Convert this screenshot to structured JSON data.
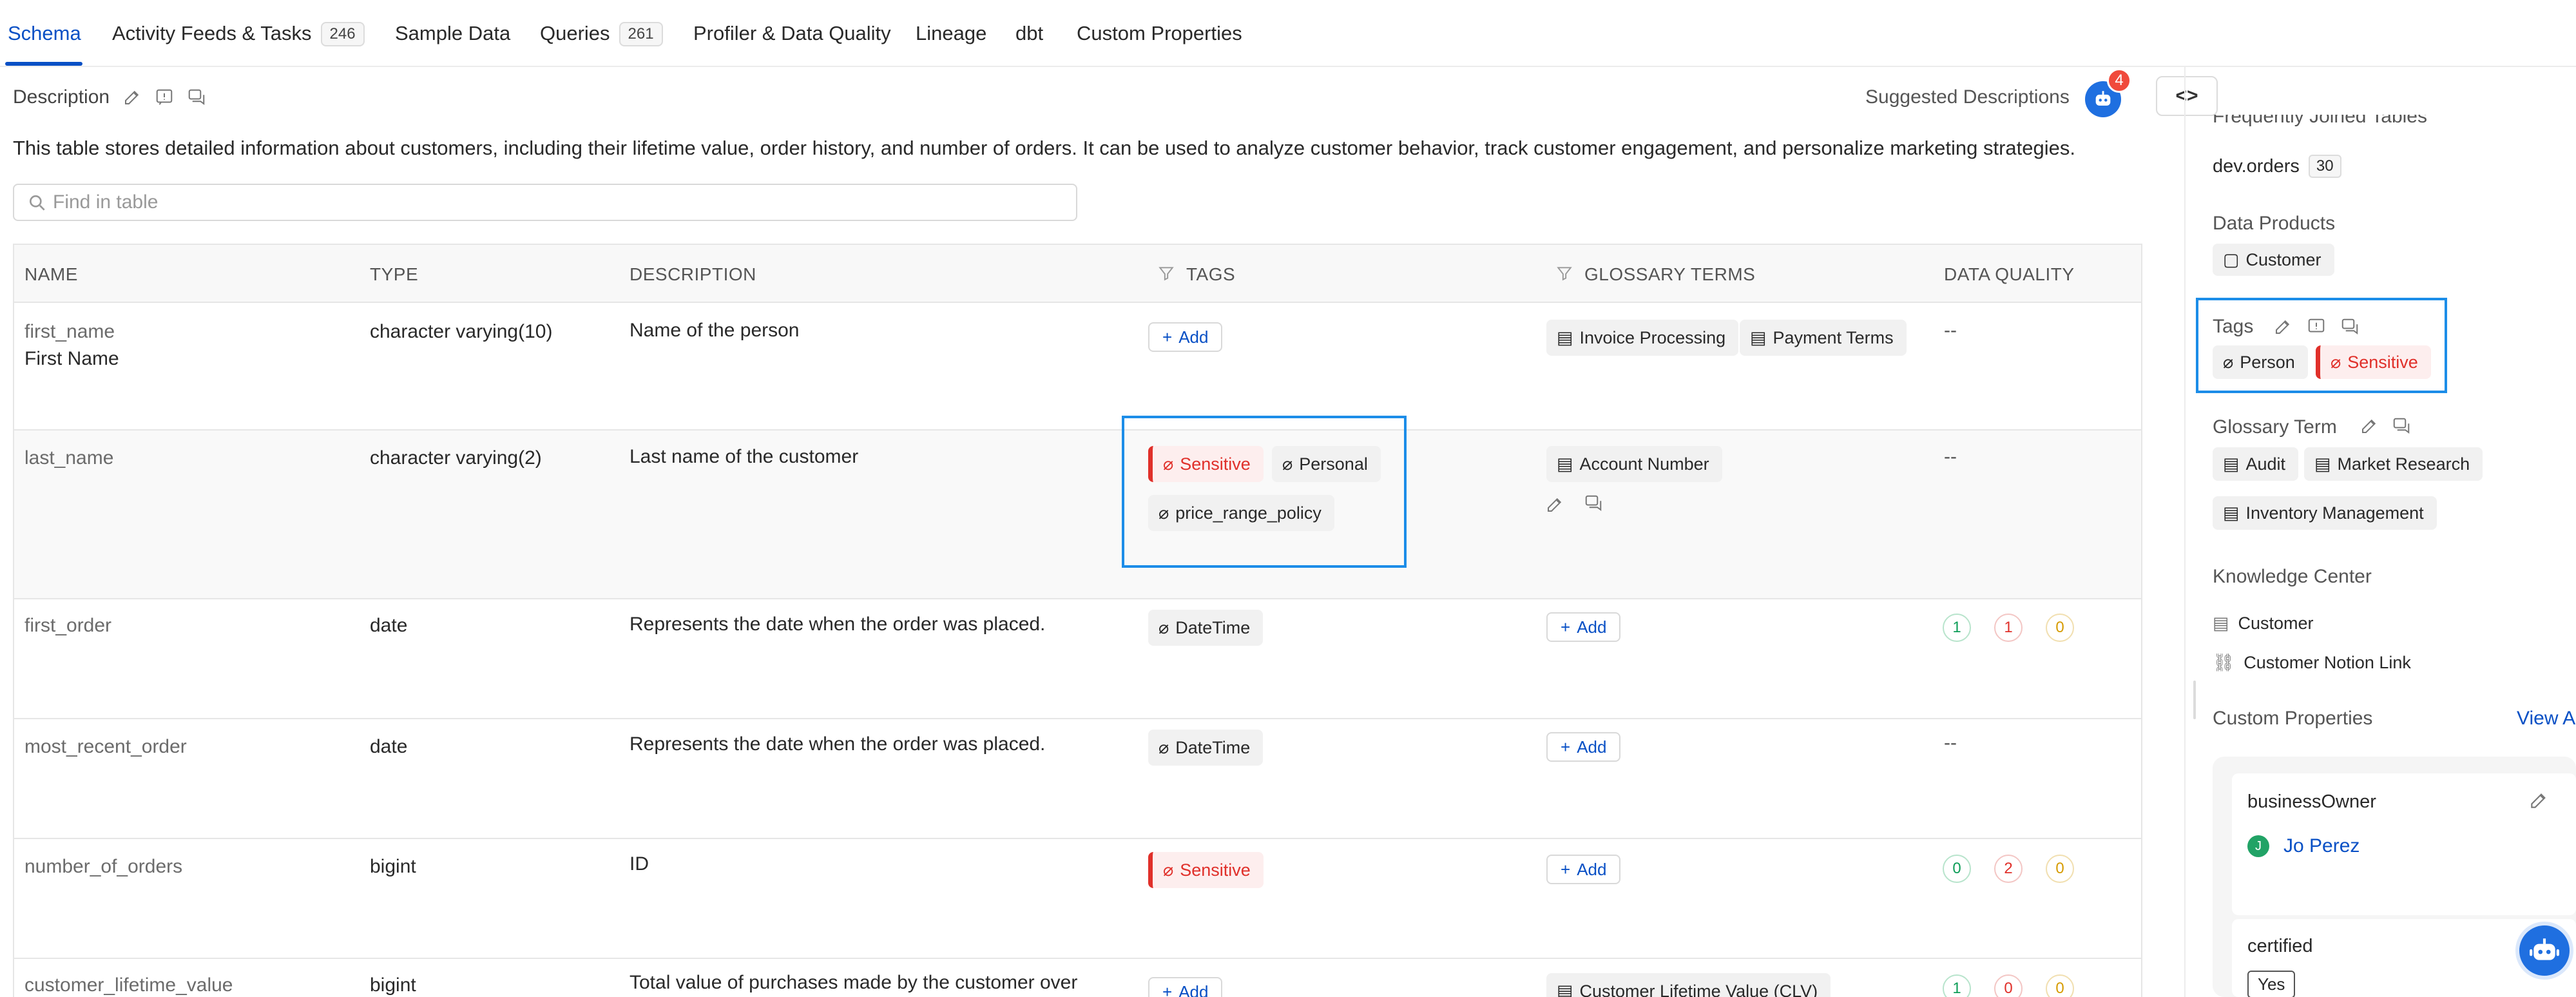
{
  "tabs": [
    {
      "label": "Schema",
      "count": null,
      "active": true
    },
    {
      "label": "Activity Feeds & Tasks",
      "count": "246"
    },
    {
      "label": "Sample Data",
      "count": null
    },
    {
      "label": "Queries",
      "count": "261"
    },
    {
      "label": "Profiler & Data Quality",
      "count": null
    },
    {
      "label": "Lineage",
      "count": null
    },
    {
      "label": "dbt",
      "count": null
    },
    {
      "label": "Custom Properties",
      "count": null
    }
  ],
  "description": {
    "label": "Description",
    "text": "This table stores detailed information about customers, including their lifetime value, order history, and number of orders. It can be used to analyze customer behavior, track customer engagement, and personalize marketing strategies.",
    "suggested_label": "Suggested Descriptions",
    "suggested_count": "4"
  },
  "search": {
    "placeholder": "Find in table"
  },
  "table": {
    "headers": {
      "name": "NAME",
      "type": "TYPE",
      "description": "DESCRIPTION",
      "tags": "TAGS",
      "glossary": "GLOSSARY TERMS",
      "quality": "DATA QUALITY"
    },
    "add_label": "Add",
    "empty": "--",
    "rows": [
      {
        "name": "first_name",
        "display_name": "First Name",
        "type": "character varying(10)",
        "description": "Name of the person",
        "tags": [],
        "glossary": [
          "Invoice Processing",
          "Payment Terms"
        ],
        "quality": null
      },
      {
        "name": "last_name",
        "type": "character varying(2)",
        "description": "Last name of the customer",
        "tags": [
          "Sensitive",
          "Personal",
          "price_range_policy"
        ],
        "glossary": [
          "Account Number"
        ],
        "quality": null
      },
      {
        "name": "first_order",
        "type": "date",
        "description": "Represents the date when the order was placed.",
        "tags": [
          "DateTime"
        ],
        "glossary": [],
        "quality": [
          "1",
          "1",
          "0"
        ]
      },
      {
        "name": "most_recent_order",
        "type": "date",
        "description": "Represents the date when the order was placed.",
        "tags": [
          "DateTime"
        ],
        "glossary": [],
        "quality": null
      },
      {
        "name": "number_of_orders",
        "type": "bigint",
        "description": "ID",
        "tags": [
          "Sensitive"
        ],
        "glossary": [],
        "quality": [
          "0",
          "2",
          "0"
        ]
      },
      {
        "name": "customer_lifetime_value",
        "type": "bigint",
        "description": "Total value of purchases made by the customer over",
        "tags": [],
        "glossary": [
          "Customer Lifetime Value (CLV)"
        ],
        "quality": [
          "1",
          "0",
          "0"
        ]
      }
    ]
  },
  "right_panel": {
    "frequently_joined_label": "Frequently Joined Tables",
    "joined_table": "dev.orders",
    "joined_count": "30",
    "data_products_label": "Data Products",
    "data_product": "Customer",
    "tags_label": "Tags",
    "tags": [
      "Person",
      "Sensitive"
    ],
    "glossary_label": "Glossary Term",
    "glossary": [
      "Audit",
      "Market Research",
      "Inventory Management"
    ],
    "knowledge_label": "Knowledge Center",
    "knowledge": [
      "Customer",
      "Customer Notion Link"
    ],
    "custom_props_label": "Custom Properties",
    "view_all": "View A",
    "business_owner_label": "businessOwner",
    "business_owner": "Jo Perez",
    "business_owner_initial": "J",
    "certified_label": "certified",
    "certified_value": "Yes"
  },
  "colors": {
    "accent": "#0950c5",
    "sensitive": "#e0302a",
    "highlight": "#1c8de8"
  },
  "icons": [
    "edit-icon",
    "request-icon",
    "conversation-icon",
    "search-icon",
    "filter-icon",
    "tag-icon",
    "glossary-icon",
    "plus-icon",
    "data-product-icon",
    "article-icon",
    "link-icon",
    "code-icon",
    "bot-icon"
  ]
}
